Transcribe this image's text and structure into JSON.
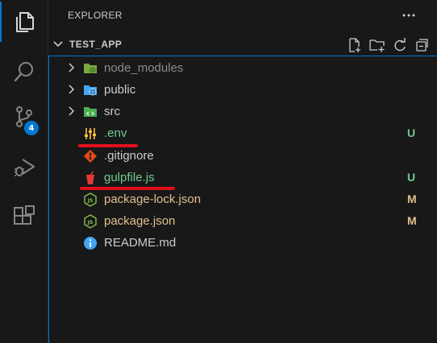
{
  "activity_bar": {
    "items": [
      {
        "icon": "explorer-icon"
      },
      {
        "icon": "search-icon"
      },
      {
        "icon": "source-control-icon",
        "badge": "4"
      },
      {
        "icon": "run-debug-icon"
      },
      {
        "icon": "extensions-icon"
      }
    ]
  },
  "sidebar": {
    "title": "EXPLORER",
    "more": "···",
    "section": {
      "title": "TEST_APP",
      "actions": [
        "new-file-icon",
        "new-folder-icon",
        "refresh-icon",
        "collapse-all-icon"
      ]
    }
  },
  "tree": {
    "items": [
      {
        "name": "node_modules",
        "type": "folder",
        "status": ""
      },
      {
        "name": "public",
        "type": "folder",
        "status": ""
      },
      {
        "name": "src",
        "type": "folder",
        "status": ""
      },
      {
        "name": ".env",
        "type": "file",
        "status": "U"
      },
      {
        "name": ".gitignore",
        "type": "file",
        "status": ""
      },
      {
        "name": "gulpfile.js",
        "type": "file",
        "status": "U"
      },
      {
        "name": "package-lock.json",
        "type": "file",
        "status": "M"
      },
      {
        "name": "package.json",
        "type": "file",
        "status": "M"
      },
      {
        "name": "README.md",
        "type": "file",
        "status": ""
      }
    ]
  },
  "colors": {
    "accent": "#0078d4",
    "untracked": "#73c991",
    "modified": "#e2c08d",
    "ignored": "#8c8c8c",
    "default_text": "#cccccc",
    "annotation": "#e0101a"
  }
}
